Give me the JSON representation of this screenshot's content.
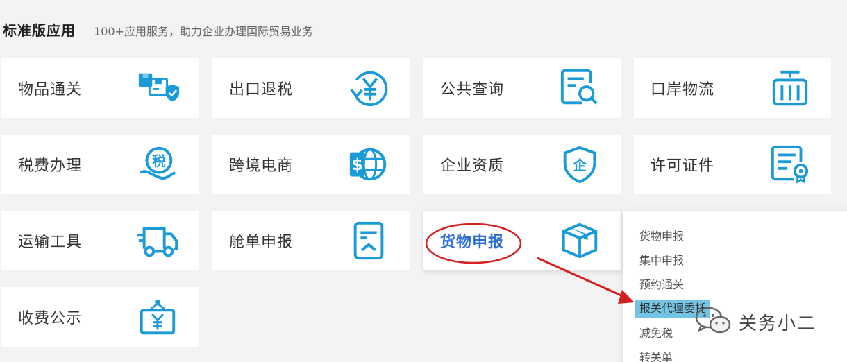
{
  "header": {
    "title": "标准版应用",
    "subtitle": "100+应用服务，助力企业办理国际贸易业务"
  },
  "cards": [
    {
      "label": "物品通关",
      "icon": "goods-clearance-icon"
    },
    {
      "label": "出口退税",
      "icon": "export-tax-refund-icon"
    },
    {
      "label": "公共查询",
      "icon": "public-query-icon"
    },
    {
      "label": "口岸物流",
      "icon": "port-logistics-icon"
    },
    {
      "label": "税费办理",
      "icon": "tax-payment-icon"
    },
    {
      "label": "跨境电商",
      "icon": "cross-border-ecommerce-icon"
    },
    {
      "label": "企业资质",
      "icon": "enterprise-qualification-icon"
    },
    {
      "label": "许可证件",
      "icon": "license-certificate-icon"
    },
    {
      "label": "运输工具",
      "icon": "transport-truck-icon"
    },
    {
      "label": "舱单申报",
      "icon": "manifest-declaration-icon"
    },
    {
      "label": "货物申报",
      "icon": "cargo-declaration-box-icon"
    },
    {
      "label": "收费公示",
      "icon": "fee-publicity-icon"
    }
  ],
  "dropdown": {
    "items": [
      "货物申报",
      "集中申报",
      "预约通关",
      "报关代理委托",
      "减免税",
      "转关单"
    ],
    "highlighted": "报关代理委托"
  },
  "watermark": {
    "text": "关务小二",
    "icon": "wechat-icon"
  },
  "colors": {
    "icon_blue": "#1a9ad6",
    "active_label": "#2f6fd8",
    "annotation_red": "#d42020",
    "highlight_bg": "#74c4e6"
  }
}
